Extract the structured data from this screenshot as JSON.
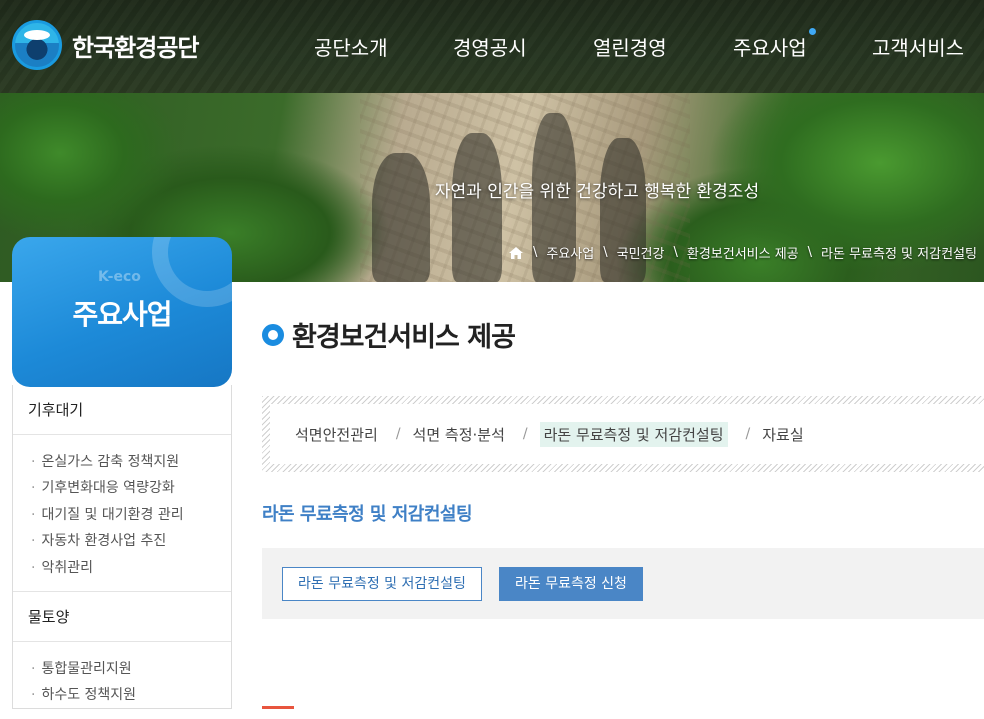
{
  "header": {
    "logo_text": "한국환경공단",
    "nav": [
      {
        "label": "공단소개"
      },
      {
        "label": "경영공시"
      },
      {
        "label": "열린경영"
      },
      {
        "label": "주요사업",
        "active": true
      },
      {
        "label": "고객서비스"
      }
    ]
  },
  "visual": {
    "slogan": "자연과 인간을 위한 건강하고 행복한 환경조성",
    "breadcrumb": [
      "주요사업",
      "국민건강",
      "환경보건서비스 제공",
      "라돈 무료측정 및 저감컨설팅"
    ]
  },
  "sidebar": {
    "brand": "K-eco",
    "title": "주요사업",
    "groups": [
      {
        "name": "기후대기",
        "items": [
          "온실가스 감축 정책지원",
          "기후변화대응 역량강화",
          "대기질 및 대기환경 관리",
          "자동차 환경사업 추진",
          "악취관리"
        ]
      },
      {
        "name": "물토양",
        "items": [
          "통합물관리지원",
          "하수도 정책지원"
        ]
      }
    ]
  },
  "content": {
    "page_title": "환경보건서비스 제공",
    "subtabs": [
      {
        "label": "석면안전관리"
      },
      {
        "label": "석면 측정·분석"
      },
      {
        "label": "라돈 무료측정 및 저감컨설팅",
        "active": true
      },
      {
        "label": "자료실"
      }
    ],
    "section_title": "라돈 무료측정 및 저감컨설팅",
    "buttons": {
      "consulting": "라돈 무료측정 및 저감컨설팅",
      "apply": "라돈 무료측정 신청"
    }
  },
  "colors": {
    "accent_blue": "#1a8ce0",
    "section_title": "#3f80c6",
    "active_tab_bg": "#e3f3ee",
    "button_blue": "#4a86c6"
  }
}
